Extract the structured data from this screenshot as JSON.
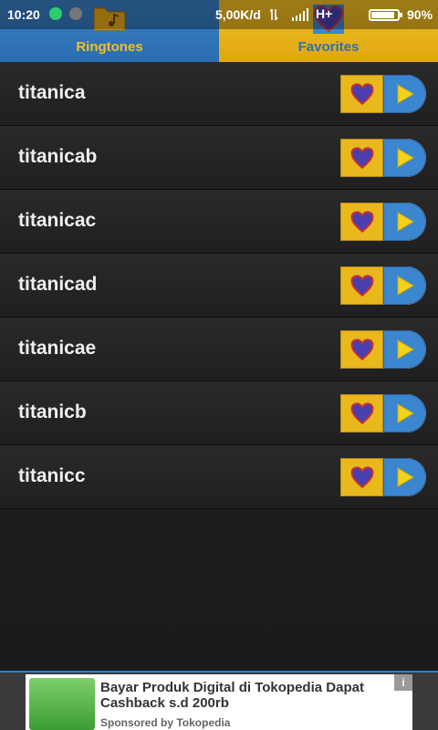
{
  "status_bar": {
    "time": "10:20",
    "speed": "5,00K/d",
    "network": "H+",
    "battery": "90%",
    "battery_level": 0.9
  },
  "tabs": [
    {
      "label": "Ringtones",
      "icon": "folder-music-icon"
    },
    {
      "label": "Favorites",
      "icon": "heart-icon"
    }
  ],
  "ringtones": [
    {
      "title": "titanica"
    },
    {
      "title": "titanicab"
    },
    {
      "title": "titanicac"
    },
    {
      "title": "titanicad"
    },
    {
      "title": "titanicae"
    },
    {
      "title": "titanicb"
    },
    {
      "title": "titanicc"
    }
  ],
  "ad": {
    "title": "Bayar Produk Digital di Tokopedia Dapat Cashback s.d 200rb",
    "sponsor": "Sponsored by Tokopedia",
    "info": "i"
  },
  "colors": {
    "tab_blue": "#2f73b8",
    "tab_yellow": "#e8b21a",
    "heart": "#4b3fb0",
    "play": "#f2d21a"
  }
}
